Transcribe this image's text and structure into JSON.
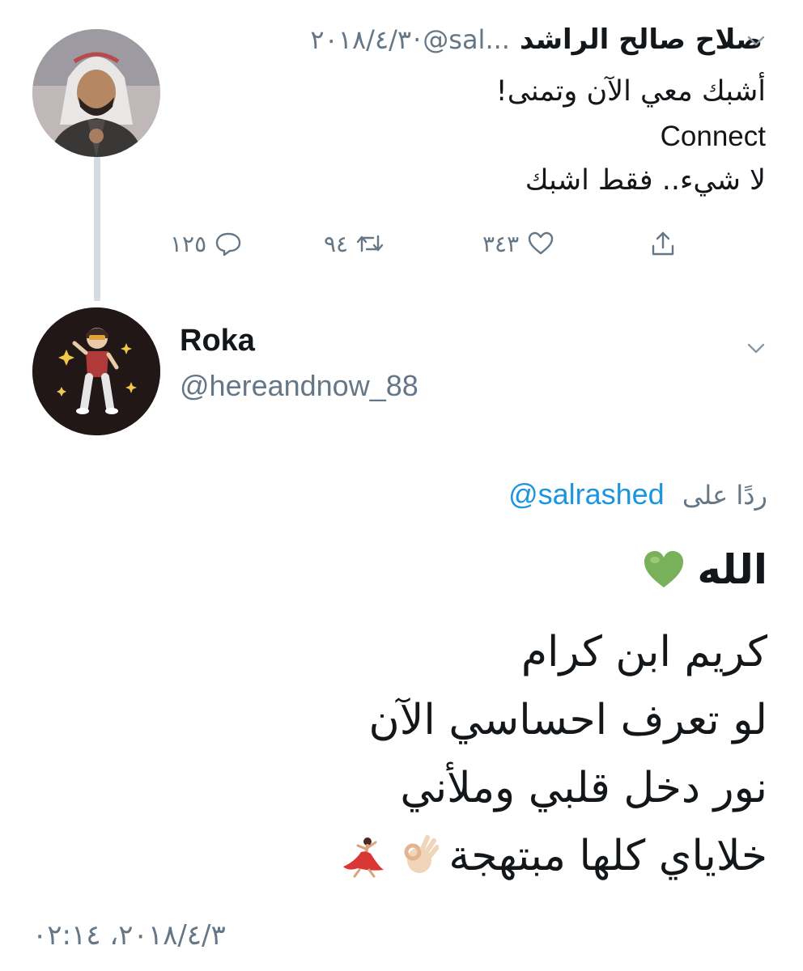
{
  "parent_tweet": {
    "author_name": "صلاح صالح الراشد",
    "handle": "@sal...",
    "separator": "·",
    "date": "٢٠١٨/٤/٣",
    "lines": [
      "أشبك معي الآن وتمنى!",
      "Connect",
      "لا شيء.. فقط اشبك"
    ],
    "actions": {
      "reply_count": "١٢٥",
      "retweet_count": "٩٤",
      "like_count": "٣٤٣"
    }
  },
  "reply_tweet": {
    "author_name": "Roka",
    "handle": "@hereandnow_88",
    "replying_prefix": "ردًا على",
    "replying_to": "@salrashed",
    "line1": "الله",
    "lines": [
      "كريم ابن كرام",
      "لو تعرف احساسي الآن",
      "نور دخل قلبي وملأني",
      "خلاياي كلها مبتهجة"
    ],
    "timestamp": "٢٠١٨/٤/٣، ٠٢:١٤"
  },
  "colors": {
    "text": "#14171a",
    "muted": "#657786",
    "link": "#1b95e0",
    "thread_line": "#d6dbe0",
    "heart_emoji": "#78b159"
  },
  "icons": [
    "chevron-down-icon",
    "reply-icon",
    "retweet-icon",
    "like-icon",
    "share-icon",
    "green-heart-emoji",
    "ok-hand-emoji",
    "dancer-emoji"
  ]
}
